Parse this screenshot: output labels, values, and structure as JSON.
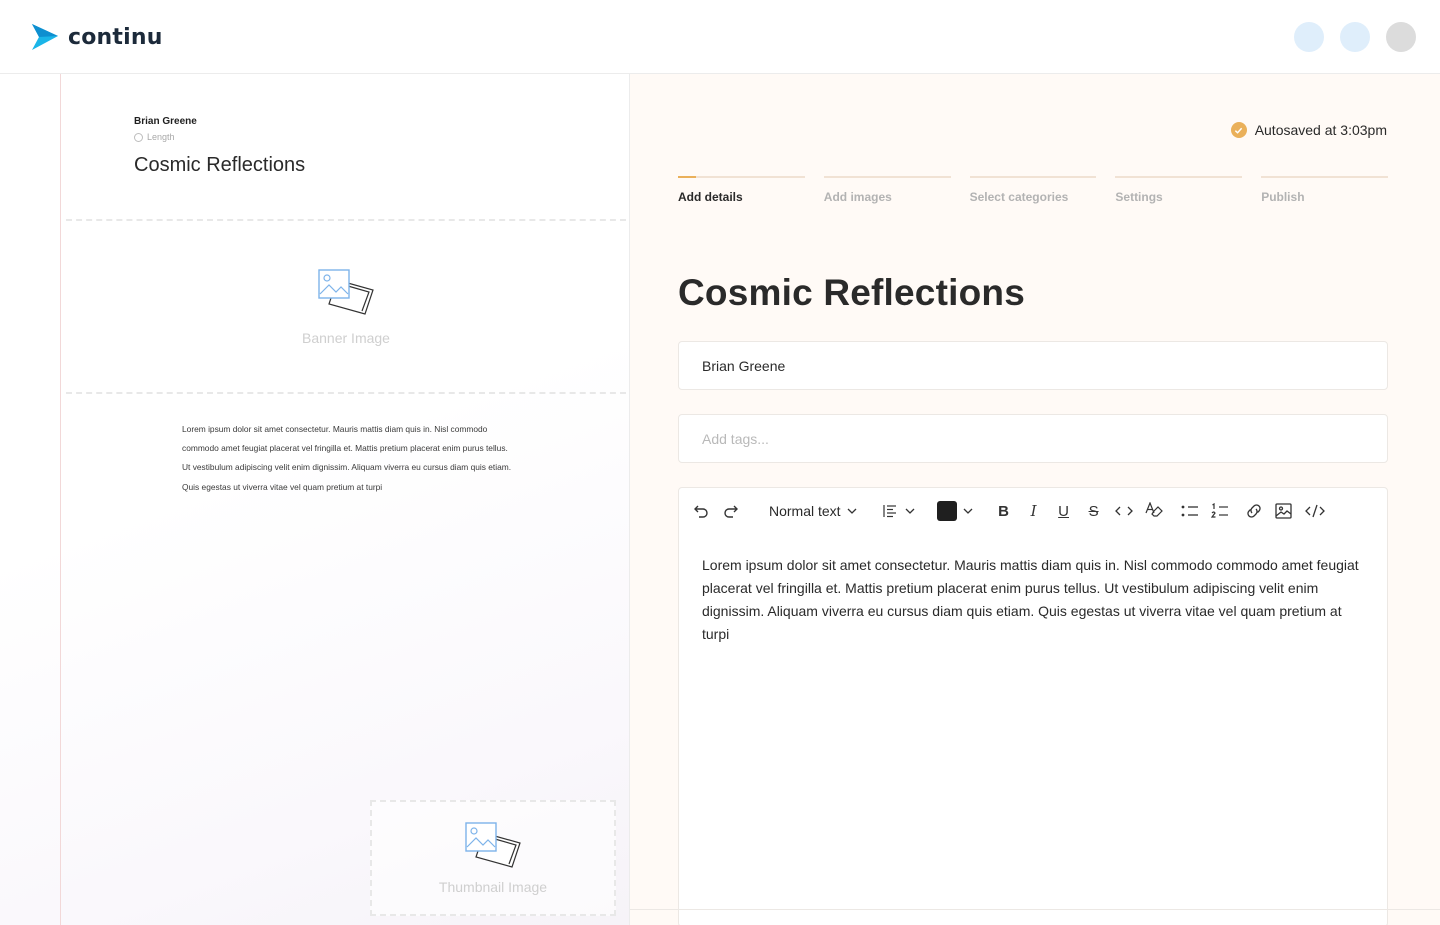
{
  "header": {
    "logo_text": "continu",
    "brand_color": "#1ab5e8",
    "avatars": [
      "#dfeefb",
      "#dfeefb",
      "#dcdcdc"
    ]
  },
  "preview": {
    "author": "Brian Greene",
    "length_label": "Length",
    "title": "Cosmic Reflections",
    "banner_label": "Banner Image",
    "body": "Lorem ipsum dolor sit amet consectetur. Mauris mattis diam quis in. Nisl commodo commodo amet feugiat placerat vel fringilla et. Mattis pretium placerat enim purus tellus. Ut vestibulum adipiscing velit enim dignissim. Aliquam viverra eu cursus diam quis etiam. Quis egestas ut viverra vitae vel quam pretium at turpi",
    "thumbnail_label": "Thumbnail Image"
  },
  "editor": {
    "autosave_text": "Autosaved at 3:03pm",
    "accent_color": "#eab05a",
    "steps": [
      {
        "label": "Add details",
        "active": true
      },
      {
        "label": "Add images",
        "active": false
      },
      {
        "label": "Select categories",
        "active": false
      },
      {
        "label": "Settings",
        "active": false
      },
      {
        "label": "Publish",
        "active": false
      }
    ],
    "title": "Cosmic Reflections",
    "author_value": "Brian Greene",
    "tags_placeholder": "Add tags...",
    "toolbar": {
      "text_style": "Normal text",
      "text_color": "#1f1f1f",
      "icons": [
        "undo-icon",
        "redo-icon",
        "align-icon",
        "bold-icon",
        "italic-icon",
        "underline-icon",
        "strikethrough-icon",
        "code-icon",
        "clear-format-icon",
        "bullet-list-icon",
        "numbered-list-icon",
        "link-icon",
        "image-icon",
        "code-block-icon"
      ]
    },
    "body": "Lorem ipsum dolor sit amet consectetur. Mauris mattis diam quis in. Nisl commodo commodo amet feugiat placerat vel fringilla et. Mattis pretium placerat enim purus tellus. Ut vestibulum adipiscing velit enim dignissim. Aliquam viverra eu cursus diam quis etiam. Quis egestas ut viverra vitae vel quam pretium at turpi"
  }
}
